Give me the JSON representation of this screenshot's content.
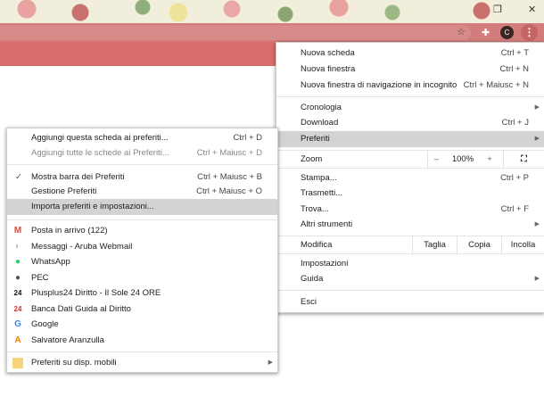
{
  "window": {
    "maximize_icon": "restore-icon",
    "close_label": "✕"
  },
  "toolbar": {
    "profile_initial": "C"
  },
  "main_menu": {
    "items": [
      {
        "label": "Nuova scheda",
        "shortcut": "Ctrl + T"
      },
      {
        "label": "Nuova finestra",
        "shortcut": "Ctrl + N"
      },
      {
        "label": "Nuova finestra di navigazione in incognito",
        "shortcut": "Ctrl + Maiusc + N"
      },
      {
        "label": "Cronologia"
      },
      {
        "label": "Download",
        "shortcut": "Ctrl + J"
      },
      {
        "label": "Preferiti"
      },
      {
        "label": "Stampa...",
        "shortcut": "Ctrl + P"
      },
      {
        "label": "Trasmetti..."
      },
      {
        "label": "Trova...",
        "shortcut": "Ctrl + F"
      },
      {
        "label": "Altri strumenti"
      },
      {
        "label": "Impostazioni"
      },
      {
        "label": "Guida"
      },
      {
        "label": "Esci"
      }
    ],
    "zoom": {
      "label": "Zoom",
      "minus": "–",
      "value": "100%",
      "plus": "+"
    },
    "edit": {
      "label": "Modifica",
      "cut": "Taglia",
      "copy": "Copia",
      "paste": "Incolla"
    }
  },
  "bookmarks_menu": {
    "items": [
      {
        "label": "Aggiungi questa scheda ai preferiti...",
        "shortcut": "Ctrl + D"
      },
      {
        "label": "Aggiungi tutte le schede ai Preferiti...",
        "shortcut": "Ctrl + Maiusc + D"
      },
      {
        "label": "Mostra barra dei Preferiti",
        "shortcut": "Ctrl + Maiusc + B",
        "check": "✓"
      },
      {
        "label": "Gestione Preferiti",
        "shortcut": "Ctrl + Maiusc + O"
      },
      {
        "label": "Importa preferiti e impostazioni..."
      }
    ],
    "bookmarks": [
      {
        "label": "Posta in arrivo (122)",
        "icon": "M",
        "color": "#ea4335"
      },
      {
        "label": "Messaggi - Aruba Webmail",
        "icon": "◐",
        "color": "#bbbbbb"
      },
      {
        "label": "WhatsApp",
        "icon": "●",
        "color": "#25d366"
      },
      {
        "label": "PEC",
        "icon": "●",
        "color": "#555555"
      },
      {
        "label": "Plusplus24 Diritto - Il Sole 24 ORE",
        "icon": "24",
        "color": "#111111"
      },
      {
        "label": "Banca Dati Guida al Diritto",
        "icon": "24",
        "color": "#d32f2f"
      },
      {
        "label": "Google",
        "icon": "G",
        "color": "#4285f4"
      },
      {
        "label": "Salvatore Aranzulla",
        "icon": "A",
        "color": "#f57c00"
      }
    ],
    "mobile": {
      "label": "Preferiti su disp. mobili"
    }
  }
}
